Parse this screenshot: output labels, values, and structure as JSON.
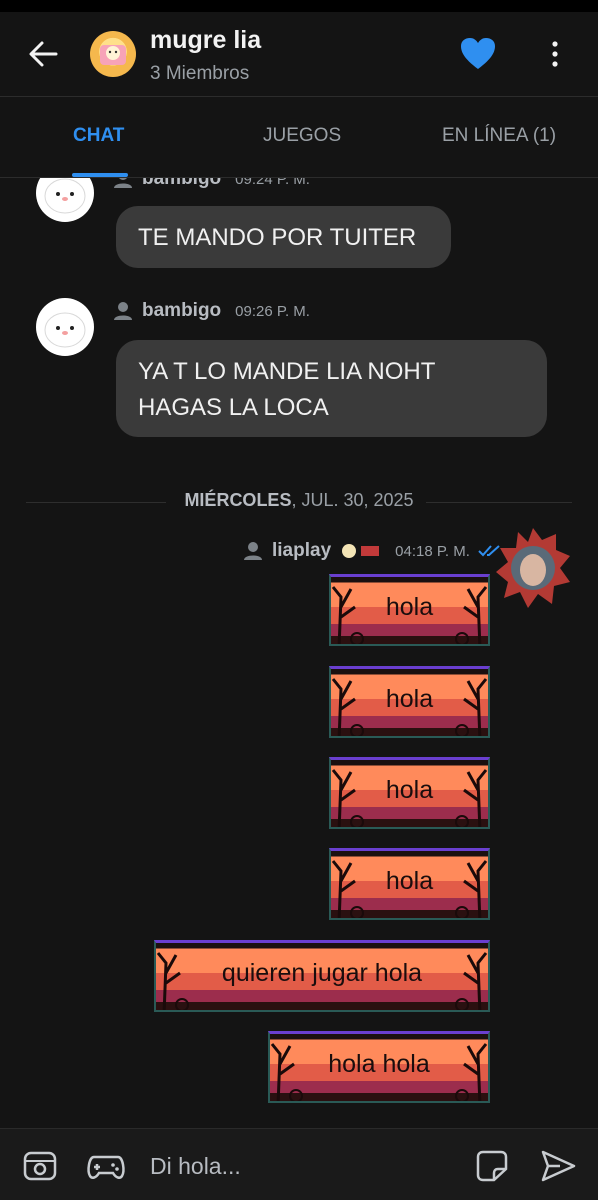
{
  "header": {
    "title": "mugre lia",
    "subtitle": "3 Miembros"
  },
  "tabs": [
    {
      "label": "CHAT",
      "active": true
    },
    {
      "label": "JUEGOS",
      "active": false
    },
    {
      "label": "EN LÍNEA (1)",
      "active": false
    }
  ],
  "messages": [
    {
      "sender": "bambigo",
      "time": "09:24 P. M.",
      "text": "TE MANDO POR TUITER"
    },
    {
      "sender": "bambigo",
      "time": "09:26 P. M.",
      "text_line1": "YA T LO MANDE LIA NOHT",
      "text_line2": "HAGAS LA LOCA"
    }
  ],
  "date_separator": {
    "day": "MIÉRCOLES",
    "date": ", JUL. 30, 2025"
  },
  "my_group": {
    "sender": "liaplay",
    "time": "04:18 P. M.",
    "stickers": [
      "hola",
      "hola",
      "hola",
      "hola",
      "quieren jugar hola",
      "hola hola"
    ]
  },
  "composer": {
    "placeholder": "Di hola..."
  },
  "colors": {
    "accent": "#2f8ff0",
    "background": "#141414",
    "bubble": "#3a3a3a"
  },
  "icons": [
    "back-arrow-icon",
    "heart-icon",
    "more-vert-icon",
    "member-icon",
    "read-check-icon",
    "sticker-panel-icon",
    "game-controller-icon",
    "sticker-icon",
    "send-icon"
  ]
}
